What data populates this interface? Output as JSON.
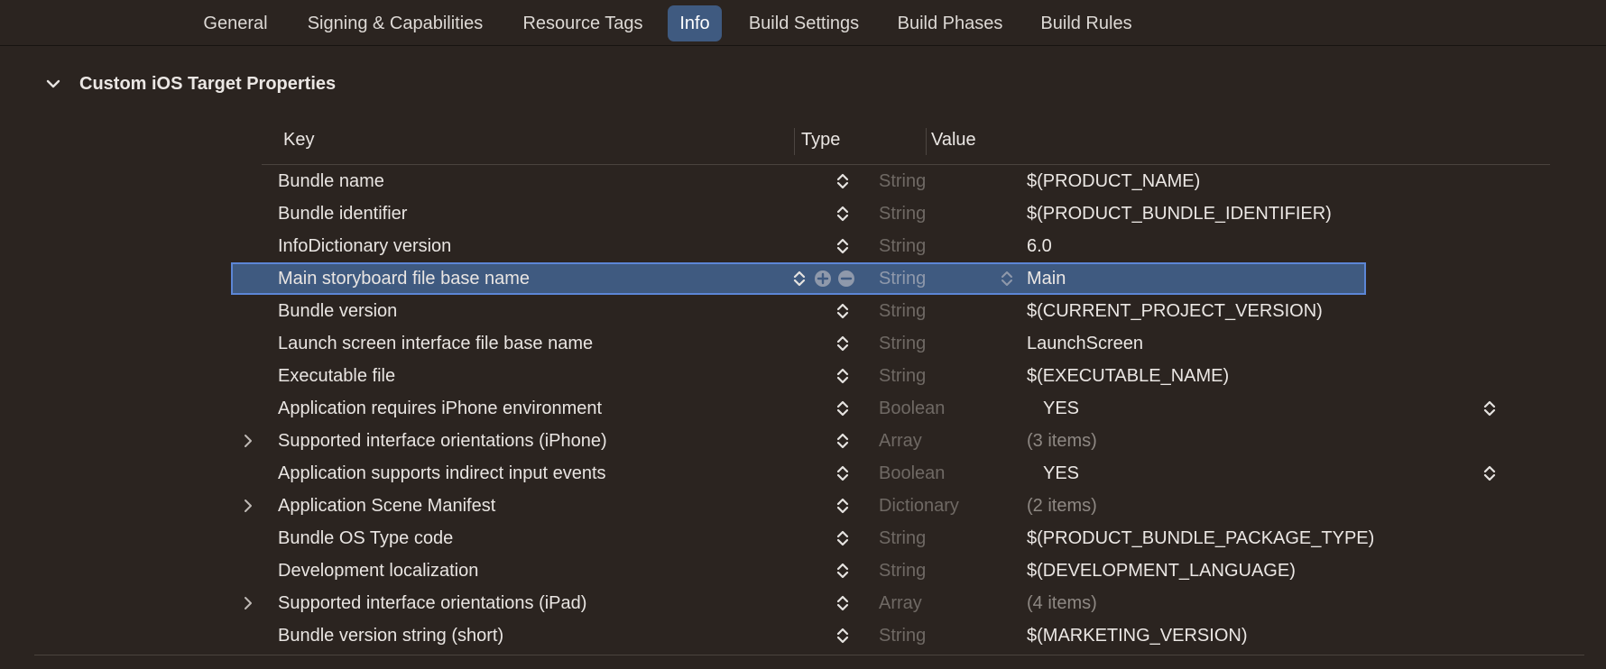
{
  "tabs": [
    {
      "label": "General",
      "active": false
    },
    {
      "label": "Signing & Capabilities",
      "active": false
    },
    {
      "label": "Resource Tags",
      "active": false
    },
    {
      "label": "Info",
      "active": true
    },
    {
      "label": "Build Settings",
      "active": false
    },
    {
      "label": "Build Phases",
      "active": false
    },
    {
      "label": "Build Rules",
      "active": false
    }
  ],
  "section": {
    "title": "Custom iOS Target Properties",
    "expanded": true,
    "icon": "chevron-down-icon"
  },
  "table": {
    "headers": {
      "key": "Key",
      "type": "Type",
      "value": "Value"
    },
    "rows": [
      {
        "key": "Bundle name",
        "type": "String",
        "value": "$(PRODUCT_NAME)"
      },
      {
        "key": "Bundle identifier",
        "type": "String",
        "value": "$(PRODUCT_BUNDLE_IDENTIFIER)"
      },
      {
        "key": "InfoDictionary version",
        "type": "String",
        "value": "6.0"
      },
      {
        "key": "Main storyboard file base name",
        "type": "String",
        "value": "Main",
        "selected": true
      },
      {
        "key": "Bundle version",
        "type": "String",
        "value": "$(CURRENT_PROJECT_VERSION)"
      },
      {
        "key": "Launch screen interface file base name",
        "type": "String",
        "value": "LaunchScreen"
      },
      {
        "key": "Executable file",
        "type": "String",
        "value": "$(EXECUTABLE_NAME)"
      },
      {
        "key": "Application requires iPhone environment",
        "type": "Boolean",
        "value": "YES",
        "bool": true
      },
      {
        "key": "Supported interface orientations (iPhone)",
        "type": "Array",
        "value": "(3 items)",
        "expandable": true
      },
      {
        "key": "Application supports indirect input events",
        "type": "Boolean",
        "value": "YES",
        "bool": true
      },
      {
        "key": "Application Scene Manifest",
        "type": "Dictionary",
        "value": "(2 items)",
        "expandable": true
      },
      {
        "key": "Bundle OS Type code",
        "type": "String",
        "value": "$(PRODUCT_BUNDLE_PACKAGE_TYPE)"
      },
      {
        "key": "Development localization",
        "type": "String",
        "value": "$(DEVELOPMENT_LANGUAGE)"
      },
      {
        "key": "Supported interface orientations (iPad)",
        "type": "Array",
        "value": "(4 items)",
        "expandable": true
      },
      {
        "key": "Bundle version string (short)",
        "type": "String",
        "value": "$(MARKETING_VERSION)"
      }
    ]
  },
  "colors": {
    "background": "#2b2420",
    "accent": "#3f5a80",
    "selection_border": "#5c86d6"
  },
  "icons": {
    "stepper": "up-down-stepper-icon",
    "disclosure": "chevron-right-icon",
    "add": "plus-circle-icon",
    "remove": "minus-circle-icon"
  }
}
